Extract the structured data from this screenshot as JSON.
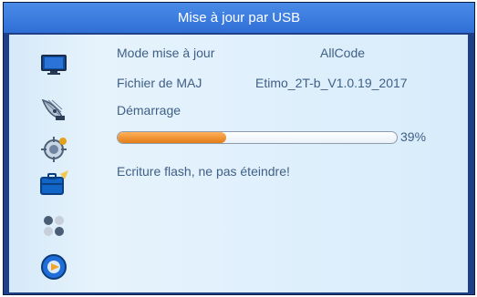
{
  "window": {
    "title": "Mise à jour par USB"
  },
  "sidebar": {
    "icons": [
      "tv-icon",
      "satellite-dish-icon",
      "gear-icon",
      "toolbox-icon",
      "apps-icon",
      "media-player-icon"
    ]
  },
  "main": {
    "rows": [
      {
        "label": "Mode mise à jour",
        "value": "AllCode"
      },
      {
        "label": "Fichier de MAJ",
        "value": "Etimo_2T-b_V1.0.19_2017"
      },
      {
        "label": "Démarrage"
      }
    ],
    "progress": {
      "percent": 39,
      "label": "39%"
    },
    "status_text": "Ecriture flash, ne pas éteindre!"
  },
  "colors": {
    "titlebar": "#3a7fe2",
    "background": "#1f3f86",
    "panel": "#d9ecfb",
    "text": "#3f5f86",
    "progress_fill": "#e27c15"
  }
}
